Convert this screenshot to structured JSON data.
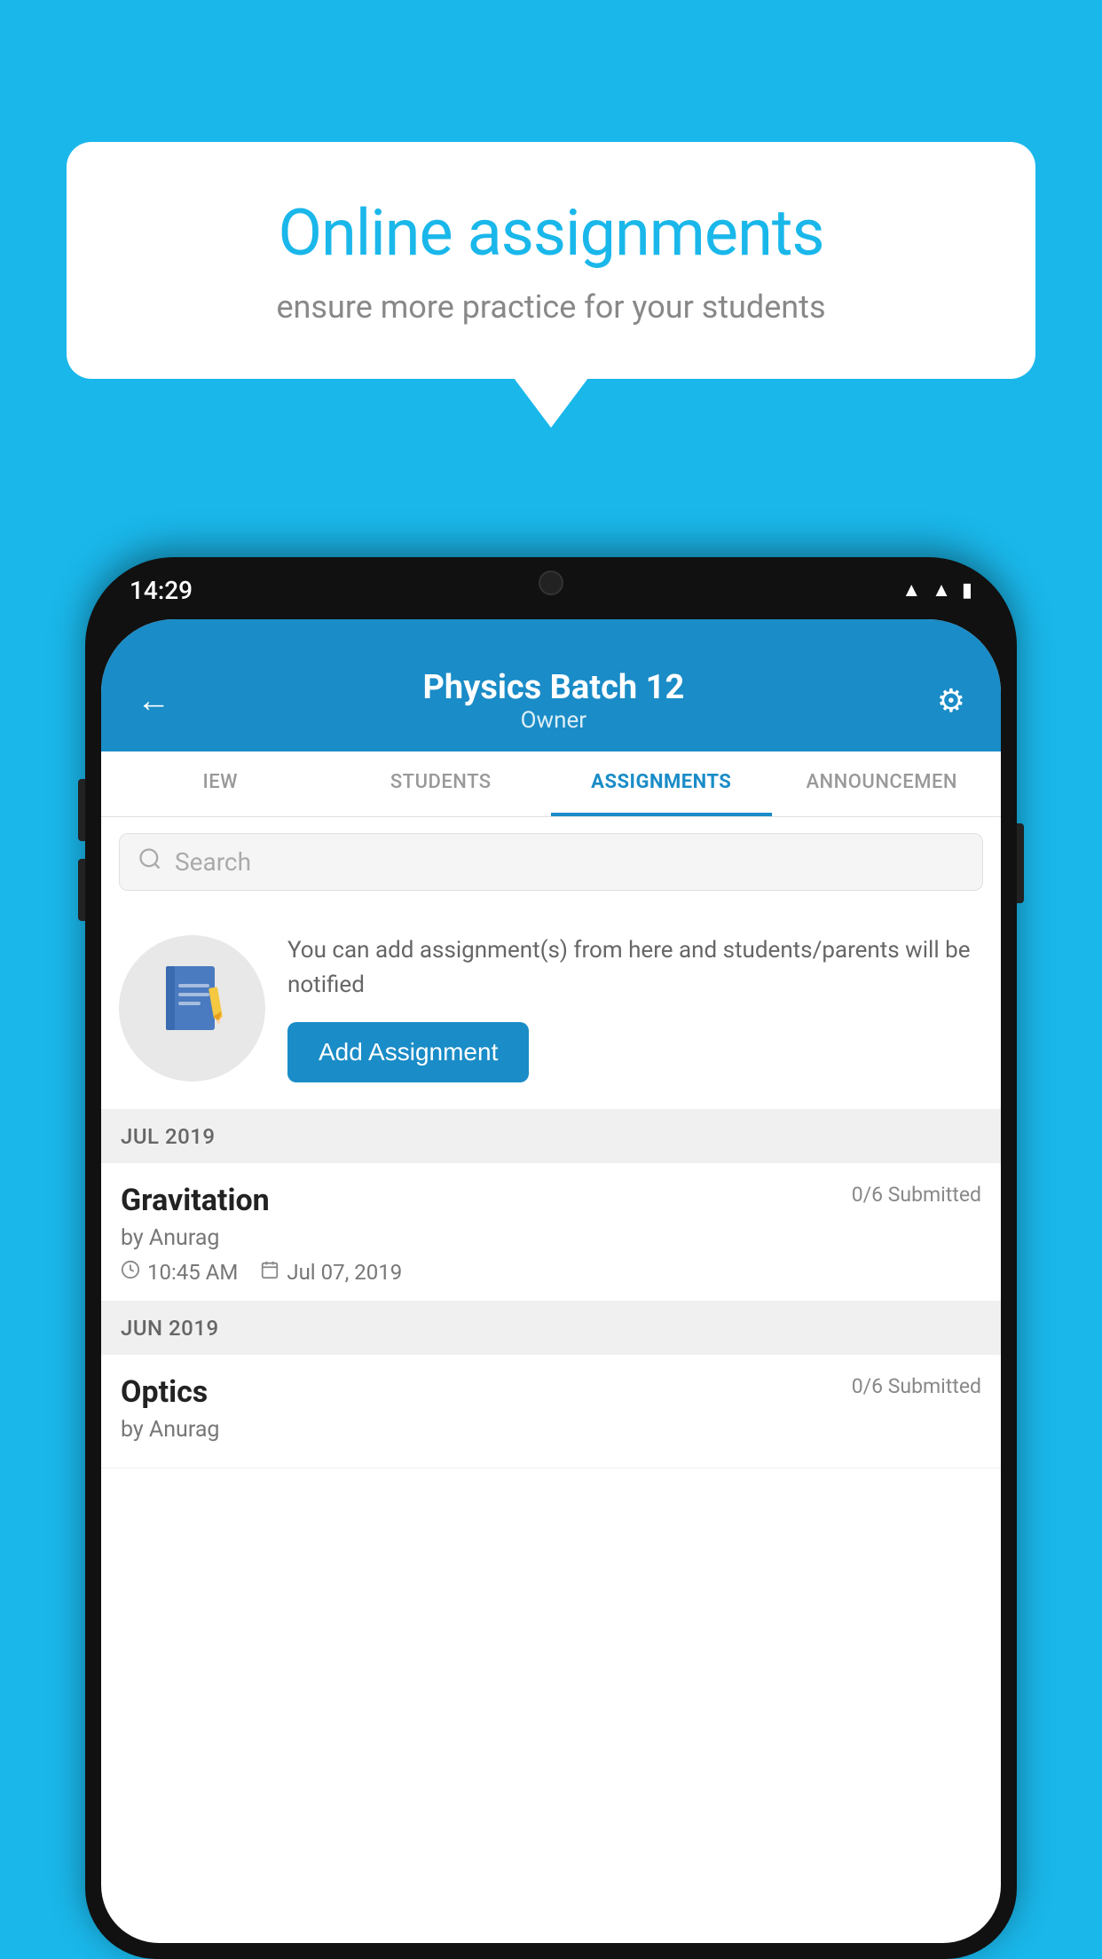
{
  "background": {
    "color": "#1ab7ea"
  },
  "speech_bubble": {
    "title": "Online assignments",
    "subtitle": "ensure more practice for your students"
  },
  "status_bar": {
    "time": "14:29",
    "icons": [
      "wifi",
      "signal",
      "battery"
    ]
  },
  "app_header": {
    "title": "Physics Batch 12",
    "subtitle": "Owner",
    "back_label": "←",
    "settings_label": "⚙"
  },
  "tabs": [
    {
      "label": "IEW",
      "active": false
    },
    {
      "label": "STUDENTS",
      "active": false
    },
    {
      "label": "ASSIGNMENTS",
      "active": true
    },
    {
      "label": "ANNOUNCEMENTS",
      "active": false
    }
  ],
  "search": {
    "placeholder": "Search"
  },
  "promo": {
    "description": "You can add assignment(s) from here and students/parents will be notified",
    "button_label": "Add Assignment"
  },
  "months": [
    {
      "label": "JUL 2019",
      "assignments": [
        {
          "title": "Gravitation",
          "submitted": "0/6 Submitted",
          "author": "by Anurag",
          "time": "10:45 AM",
          "date": "Jul 07, 2019"
        }
      ]
    },
    {
      "label": "JUN 2019",
      "assignments": [
        {
          "title": "Optics",
          "submitted": "0/6 Submitted",
          "author": "by Anurag",
          "time": "",
          "date": ""
        }
      ]
    }
  ]
}
